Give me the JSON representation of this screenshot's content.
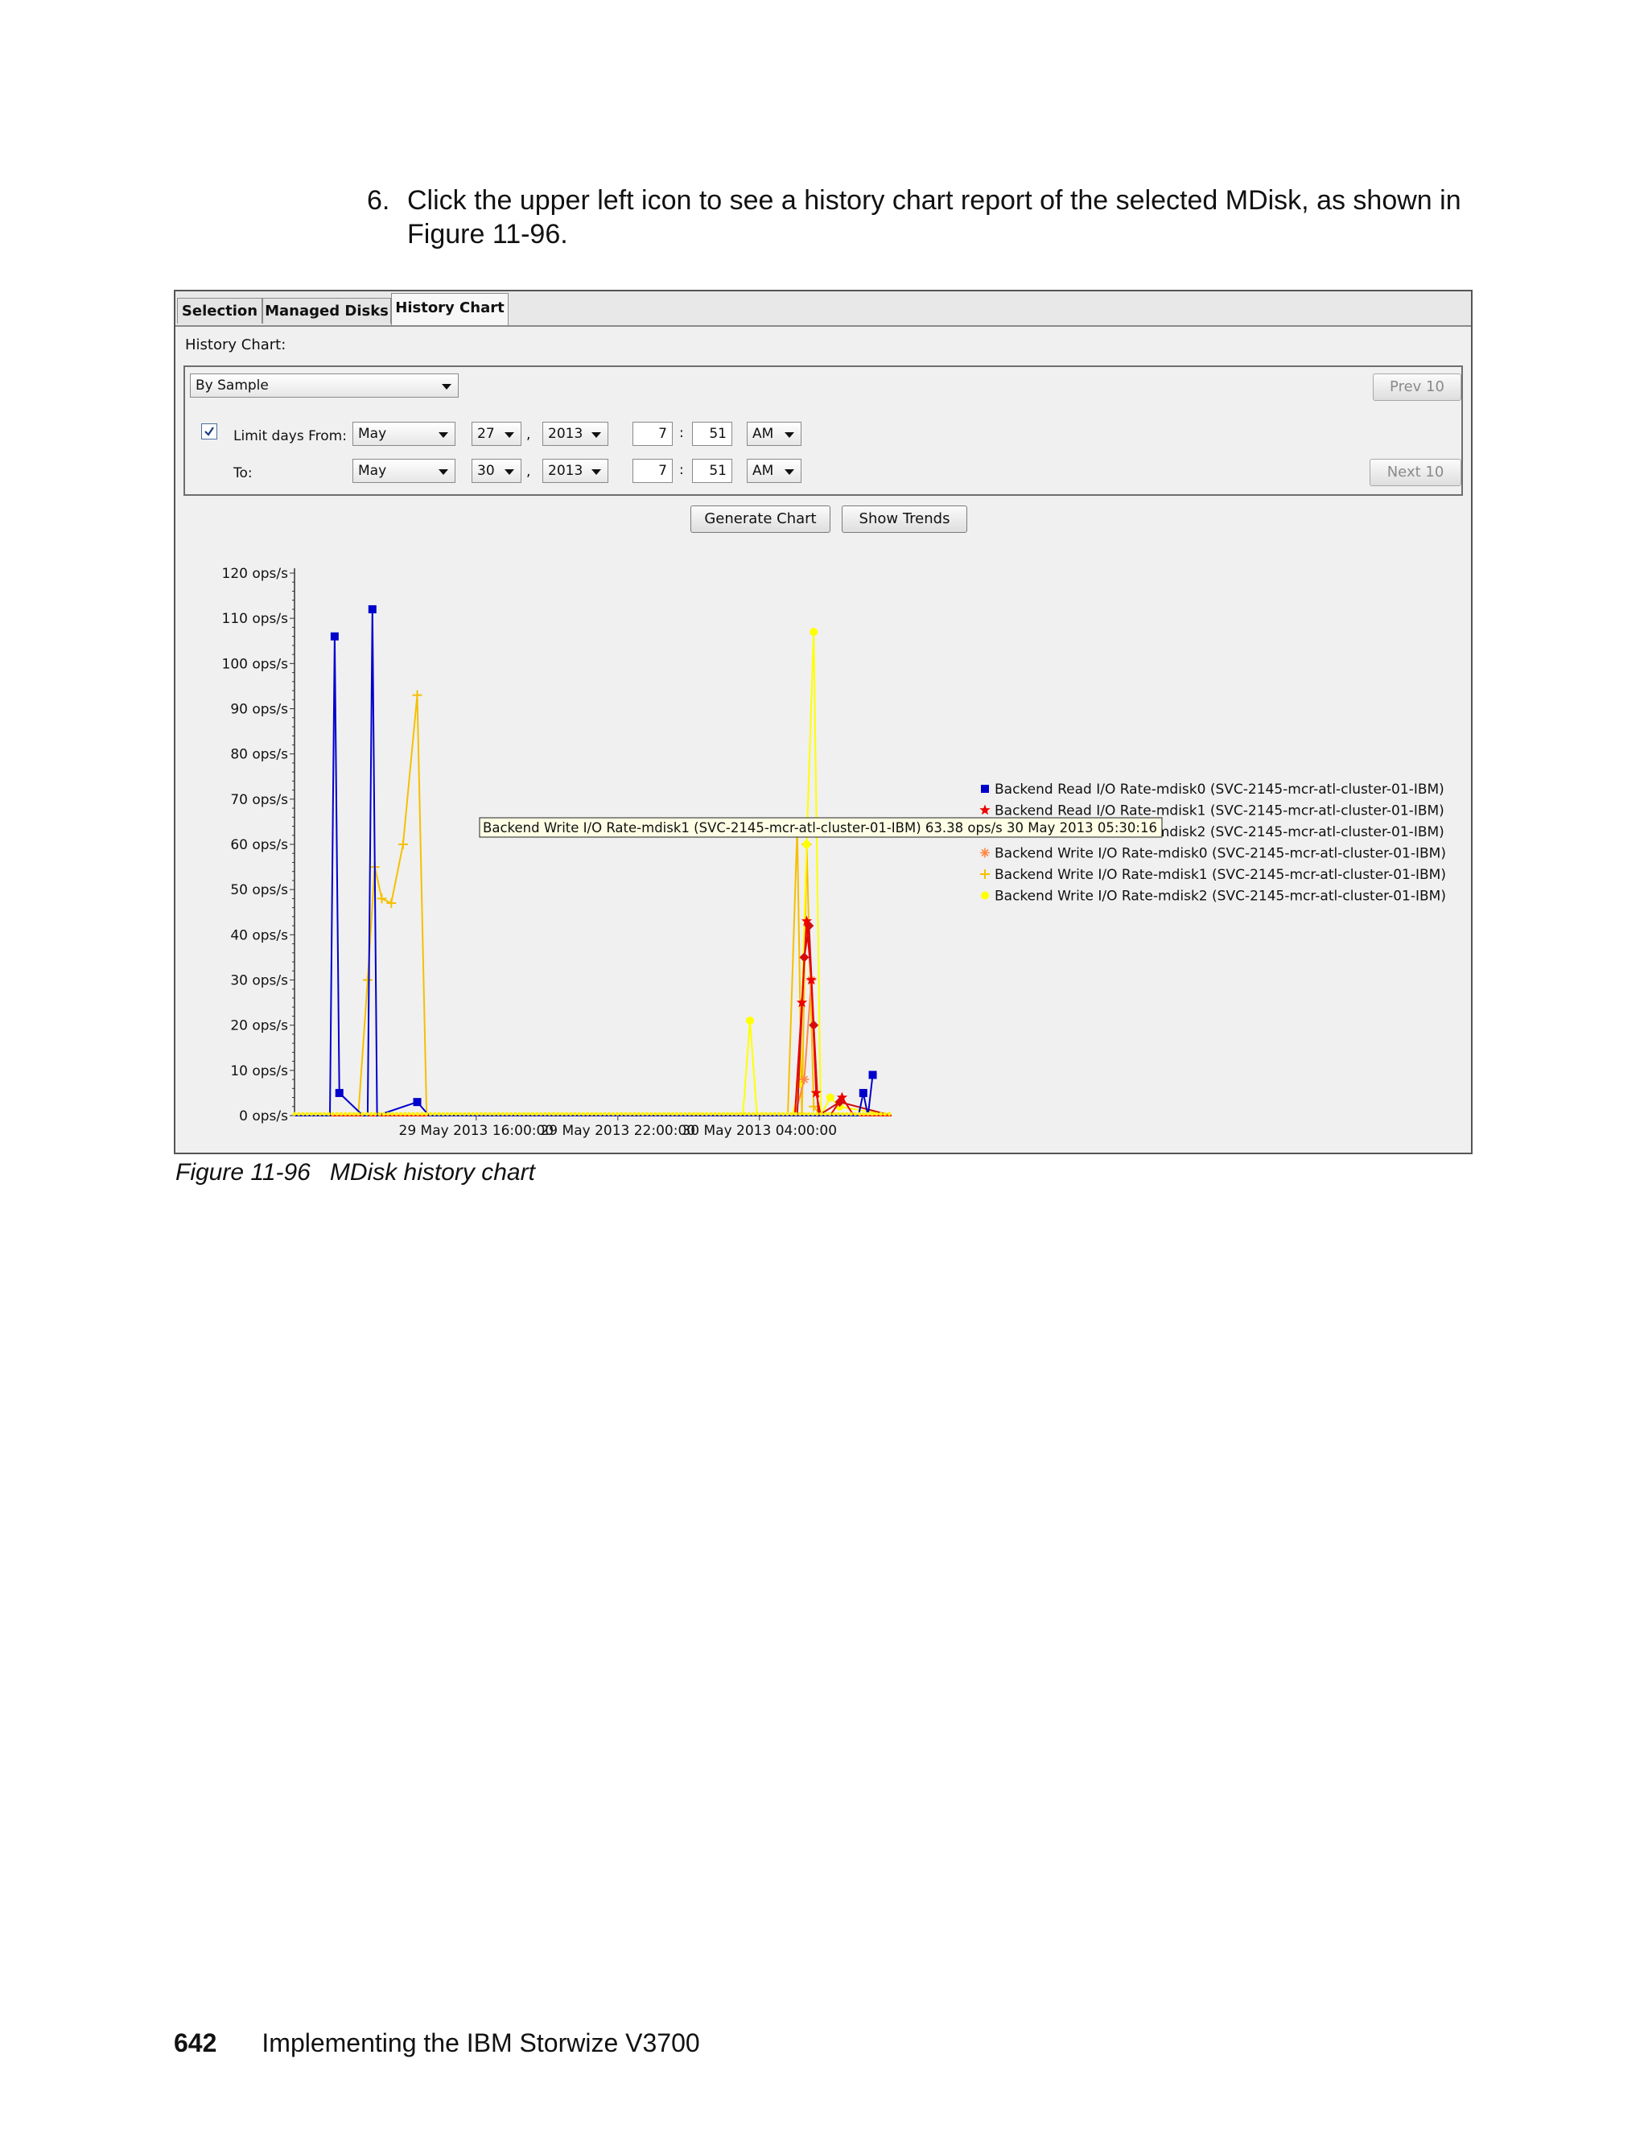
{
  "step": {
    "number": "6.",
    "text": "Click the upper left icon to see a history chart report of the selected MDisk, as shown in Figure 11-96."
  },
  "screenshot": {
    "tabs": [
      {
        "label": "Selection"
      },
      {
        "label": "Managed Disks"
      },
      {
        "label": "History Chart"
      }
    ],
    "active_tab": "History Chart",
    "history_chart_label": "History Chart:",
    "sample_select": "By Sample",
    "limit_days": {
      "label": "Limit days From:",
      "checked": true
    },
    "from": {
      "month": "May",
      "day": "27",
      "year": "2013",
      "hour": "7",
      "minute": "51",
      "ampm": "AM"
    },
    "to": {
      "label": "To:",
      "month": "May",
      "day": "30",
      "year": "2013",
      "hour": "7",
      "minute": "51",
      "ampm": "AM"
    },
    "comma": ",",
    "colon": ":",
    "buttons": {
      "prev": "Prev 10",
      "next": "Next 10",
      "generate": "Generate Chart",
      "trends": "Show Trends"
    }
  },
  "chart_data": {
    "type": "line",
    "title": "",
    "xlabel": "",
    "ylabel": "",
    "ylim": [
      0,
      120
    ],
    "y_ticks": [
      "0 ops/s",
      "10 ops/s",
      "20 ops/s",
      "30 ops/s",
      "40 ops/s",
      "50 ops/s",
      "60 ops/s",
      "70 ops/s",
      "80 ops/s",
      "90 ops/s",
      "100 ops/s",
      "110 ops/s",
      "120 ops/s"
    ],
    "x_ticks": [
      "29 May 2013 16:00:00",
      "29 May 2013 22:00:00",
      "30 May 2013 04:00:00"
    ],
    "x_tick_hours": [
      16,
      22,
      28
    ],
    "xlim_hours": [
      8.3,
      33.6
    ],
    "legend_position": "right",
    "tooltip": "Backend Write I/O Rate-mdisk1 (SVC-2145-mcr-atl-cluster-01-IBM)   63.38 ops/s   30 May 2013 05:30:16",
    "series": [
      {
        "name": "Backend Read I/O Rate-mdisk0 (SVC-2145-mcr-atl-cluster-01-IBM)",
        "color": "#0000cc",
        "marker": "square",
        "x": [
          8.3,
          9.8,
          10.0,
          10.2,
          11.2,
          11.4,
          11.6,
          11.8,
          13.5,
          14.0,
          20.0,
          26.0,
          32.2,
          32.4,
          32.6,
          32.8
        ],
        "y": [
          0,
          0,
          106,
          5,
          0,
          0,
          112,
          0,
          3,
          0,
          0,
          0,
          0,
          5,
          0,
          9
        ]
      },
      {
        "name": "Backend Read I/O Rate-mdisk1 (SVC-2145-mcr-atl-cluster-01-IBM)",
        "color": "#ee0000",
        "marker": "star",
        "x": [
          8.3,
          20.0,
          29.5,
          29.8,
          30.0,
          30.2,
          30.4,
          30.6,
          31.0,
          31.5,
          32.0,
          33.6
        ],
        "y": [
          0,
          0,
          0,
          25,
          43,
          30,
          5,
          0,
          0,
          4,
          0,
          0
        ]
      },
      {
        "name": "Backend Read I/O Rate-mdisk2 (SVC-2145-mcr-atl-cluster-01-IBM)",
        "color": "#cc1111",
        "marker": "diamond",
        "x": [
          8.3,
          29.6,
          29.9,
          30.1,
          30.3,
          30.5,
          31.4,
          33.6
        ],
        "y": [
          0,
          0,
          35,
          42,
          20,
          0,
          3,
          0
        ]
      },
      {
        "name": "Backend Write I/O Rate-mdisk0 (SVC-2145-mcr-atl-cluster-01-IBM)",
        "color": "#ff8844",
        "marker": "asterisk",
        "x": [
          8.3,
          29.5,
          29.9,
          30.2,
          30.5,
          33.6
        ],
        "y": [
          0,
          0,
          8,
          30,
          0,
          0
        ]
      },
      {
        "name": "Backend Write I/O Rate-mdisk1 (SVC-2145-mcr-atl-cluster-01-IBM)",
        "color": "#f5c000",
        "marker": "plus",
        "x": [
          8.3,
          11.0,
          11.4,
          11.7,
          12.0,
          12.4,
          12.9,
          13.5,
          13.9,
          14.0,
          20.0,
          27.0,
          29.2,
          29.6,
          29.8,
          30.0,
          30.3,
          30.6,
          33.6
        ],
        "y": [
          0,
          0,
          30,
          55,
          48,
          47,
          60,
          93,
          0,
          0,
          0,
          0,
          0,
          63.38,
          0,
          60,
          2,
          0,
          0
        ]
      },
      {
        "name": "Backend Write I/O Rate-mdisk2 (SVC-2145-mcr-atl-cluster-01-IBM)",
        "color": "#ffff00",
        "marker": "circle",
        "x": [
          8.3,
          20.0,
          27.3,
          27.6,
          27.9,
          29.4,
          29.7,
          30.0,
          30.3,
          30.6,
          31.0,
          31.4,
          33.6
        ],
        "y": [
          0,
          0,
          0,
          21,
          0,
          0,
          7,
          60,
          107,
          0,
          4,
          2,
          0
        ]
      }
    ]
  },
  "caption": {
    "figure": "Figure 11-96",
    "title": "MDisk history chart"
  },
  "footer": {
    "page_number": "642",
    "book_title": "Implementing the IBM Storwize V3700"
  }
}
